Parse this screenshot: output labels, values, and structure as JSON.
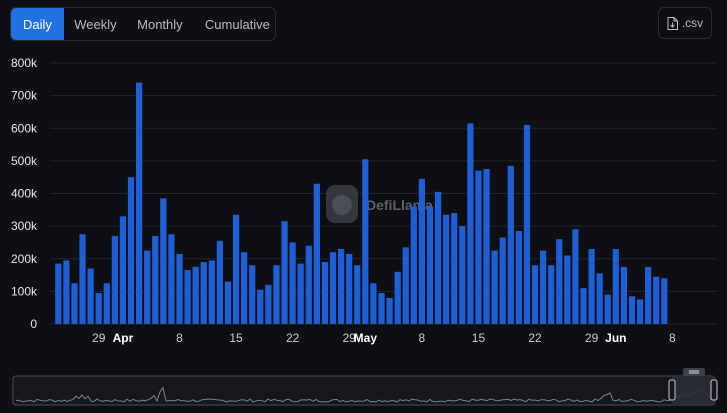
{
  "tabs": {
    "items": [
      "Daily",
      "Weekly",
      "Monthly",
      "Cumulative"
    ],
    "active": 0
  },
  "export": {
    "label": ".csv",
    "icon": "file-download-icon"
  },
  "watermark": {
    "text": "DefiLlama"
  },
  "colors": {
    "bar": "#1f5fd6",
    "accent": "#2172e5",
    "background": "#0e0f13"
  },
  "chart_data": {
    "type": "bar",
    "title": "",
    "xlabel": "",
    "ylabel": "",
    "ylim": [
      0,
      800000
    ],
    "yticks": [
      {
        "value": 0,
        "label": "0"
      },
      {
        "value": 100000,
        "label": "100k"
      },
      {
        "value": 200000,
        "label": "200k"
      },
      {
        "value": 300000,
        "label": "300k"
      },
      {
        "value": 400000,
        "label": "400k"
      },
      {
        "value": 500000,
        "label": "500k"
      },
      {
        "value": 600000,
        "label": "600k"
      },
      {
        "value": 700000,
        "label": "700k"
      },
      {
        "value": 800000,
        "label": "800k"
      }
    ],
    "categories": [
      "Mar 24",
      "Mar 25",
      "Mar 26",
      "Mar 27",
      "Mar 28",
      "Mar 29",
      "Mar 30",
      "Mar 31",
      "Apr 1",
      "Apr 2",
      "Apr 3",
      "Apr 4",
      "Apr 5",
      "Apr 6",
      "Apr 7",
      "Apr 8",
      "Apr 9",
      "Apr 10",
      "Apr 11",
      "Apr 12",
      "Apr 13",
      "Apr 14",
      "Apr 15",
      "Apr 16",
      "Apr 17",
      "Apr 18",
      "Apr 19",
      "Apr 20",
      "Apr 21",
      "Apr 22",
      "Apr 23",
      "Apr 24",
      "Apr 25",
      "Apr 26",
      "Apr 27",
      "Apr 28",
      "Apr 29",
      "Apr 30",
      "May 1",
      "May 2",
      "May 3",
      "May 4",
      "May 5",
      "May 6",
      "May 7",
      "May 8",
      "May 9",
      "May 10",
      "May 11",
      "May 12",
      "May 13",
      "May 14",
      "May 15",
      "May 16",
      "May 17",
      "May 18",
      "May 19",
      "May 20",
      "May 21",
      "May 22",
      "May 23",
      "May 24",
      "May 25",
      "May 26",
      "May 27",
      "May 28",
      "May 29",
      "May 30",
      "May 31",
      "Jun 1",
      "Jun 2",
      "Jun 3",
      "Jun 4",
      "Jun 5",
      "Jun 6",
      "Jun 7",
      "Jun 8",
      "Jun 9"
    ],
    "series": [
      {
        "values": [
          185000,
          195000,
          125000,
          275000,
          170000,
          95000,
          125000,
          270000,
          330000,
          450000,
          740000,
          225000,
          270000,
          385000,
          275000,
          215000,
          165000,
          175000,
          190000,
          195000,
          255000,
          130000,
          335000,
          220000,
          180000,
          105000,
          120000,
          180000,
          315000,
          250000,
          185000,
          240000,
          430000,
          190000,
          220000,
          230000,
          215000,
          180000,
          505000,
          125000,
          95000,
          80000,
          160000,
          235000,
          360000,
          445000,
          360000,
          405000,
          335000,
          340000,
          300000,
          615000,
          470000,
          475000,
          225000,
          265000,
          485000,
          285000,
          610000,
          180000,
          225000,
          180000,
          260000,
          210000,
          290000,
          110000,
          230000,
          155000,
          90000,
          230000,
          175000,
          85000,
          75000,
          175000,
          145000,
          140000
        ]
      }
    ],
    "xtick_labels": [
      {
        "category": "Mar 29",
        "label": "29",
        "bold": false
      },
      {
        "category": "Apr 1",
        "label": "Apr",
        "bold": true
      },
      {
        "category": "Apr 8",
        "label": "8",
        "bold": false
      },
      {
        "category": "Apr 15",
        "label": "15",
        "bold": false
      },
      {
        "category": "Apr 22",
        "label": "22",
        "bold": false
      },
      {
        "category": "Apr 29",
        "label": "29",
        "bold": false
      },
      {
        "category": "May 1",
        "label": "May",
        "bold": true
      },
      {
        "category": "May 8",
        "label": "8",
        "bold": false
      },
      {
        "category": "May 15",
        "label": "15",
        "bold": false
      },
      {
        "category": "May 22",
        "label": "22",
        "bold": false
      },
      {
        "category": "May 29",
        "label": "29",
        "bold": false
      },
      {
        "category": "Jun 1",
        "label": "Jun",
        "bold": true
      },
      {
        "category": "Jun 8",
        "label": "8",
        "bold": false
      }
    ],
    "grid": true,
    "legend": "none"
  }
}
